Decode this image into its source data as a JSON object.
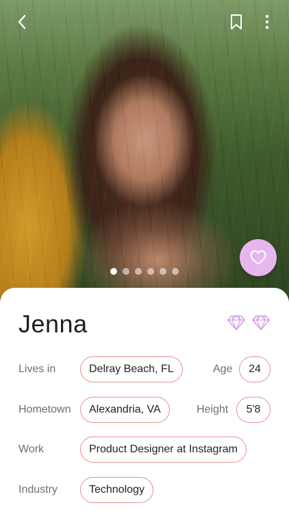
{
  "profile": {
    "name": "Jenna",
    "photo_count": 6,
    "active_photo_index": 0
  },
  "toolbar": {
    "back_icon": "chevron-left-icon",
    "bookmark_icon": "bookmark-icon",
    "more_icon": "more-vertical-icon"
  },
  "actions": {
    "like_icon": "heart-icon"
  },
  "badges": [
    "diamond-icon",
    "diamond-icon"
  ],
  "details": {
    "lives_in": {
      "label": "Lives in",
      "value": "Delray Beach, FL"
    },
    "age": {
      "label": "Age",
      "value": "24"
    },
    "hometown": {
      "label": "Hometown",
      "value": "Alexandria, VA"
    },
    "height": {
      "label": "Height",
      "value": "5'8"
    },
    "work": {
      "label": "Work",
      "value": "Product Designer at Instagram"
    },
    "industry": {
      "label": "Industry",
      "value": "Technology"
    }
  },
  "colors": {
    "accent_pink": "#e6b7ef",
    "pill_border": "#e4908e",
    "diamond": "#d59be6"
  }
}
